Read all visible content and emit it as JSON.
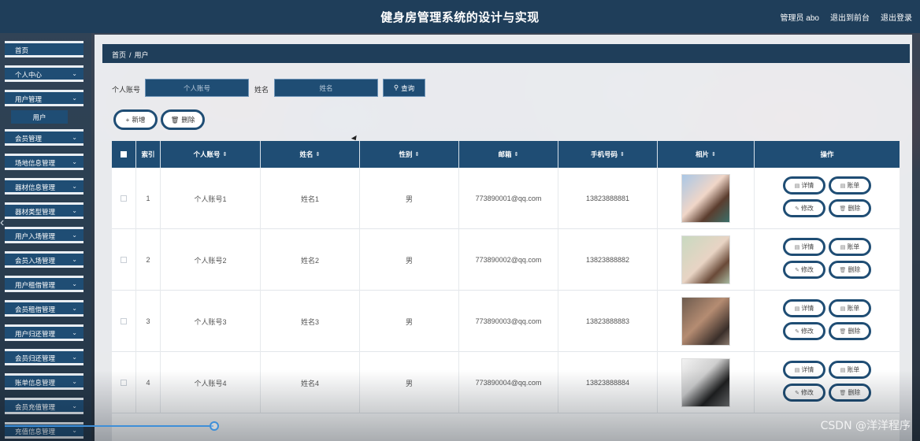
{
  "header": {
    "title": "健身房管理系统的设计与实现",
    "admin_label": "管理员 abo",
    "back_front": "退出到前台",
    "logout": "退出登录"
  },
  "sidebar": {
    "items": [
      {
        "label": "首页",
        "has_children": false
      },
      {
        "label": "个人中心",
        "has_children": true
      },
      {
        "label": "用户管理",
        "has_children": true,
        "expanded": true,
        "children": [
          {
            "label": "用户"
          }
        ]
      },
      {
        "label": "会员管理",
        "has_children": true
      },
      {
        "label": "场地信息管理",
        "has_children": true
      },
      {
        "label": "器材信息管理",
        "has_children": true
      },
      {
        "label": "器材类型管理",
        "has_children": true
      },
      {
        "label": "用户入场管理",
        "has_children": true
      },
      {
        "label": "会员入场管理",
        "has_children": true
      },
      {
        "label": "用户租借管理",
        "has_children": true
      },
      {
        "label": "会员租借管理",
        "has_children": true
      },
      {
        "label": "用户归还管理",
        "has_children": true
      },
      {
        "label": "会员归还管理",
        "has_children": true
      },
      {
        "label": "账单信息管理",
        "has_children": true
      },
      {
        "label": "会员充值管理",
        "has_children": true
      },
      {
        "label": "充值信息管理",
        "has_children": true
      }
    ]
  },
  "breadcrumb": {
    "home": "首页",
    "separator": "/",
    "current": "用户"
  },
  "search": {
    "account_label": "个人账号",
    "account_placeholder": "个人账号",
    "name_label": "姓名",
    "name_placeholder": "姓名",
    "query_button": "查询"
  },
  "actions": {
    "add": "新增",
    "delete": "删除"
  },
  "table": {
    "columns": [
      "索引",
      "个人账号",
      "姓名",
      "性别",
      "邮箱",
      "手机号码",
      "相片",
      "操作"
    ],
    "rows": [
      {
        "index": "1",
        "account": "个人账号1",
        "name": "姓名1",
        "gender": "男",
        "email": "773890001@qq.com",
        "phone": "13823888881"
      },
      {
        "index": "2",
        "account": "个人账号2",
        "name": "姓名2",
        "gender": "男",
        "email": "773890002@qq.com",
        "phone": "13823888882"
      },
      {
        "index": "3",
        "account": "个人账号3",
        "name": "姓名3",
        "gender": "男",
        "email": "773890003@qq.com",
        "phone": "13823888883"
      },
      {
        "index": "4",
        "account": "个人账号4",
        "name": "姓名4",
        "gender": "男",
        "email": "773890004@qq.com",
        "phone": "13823888884"
      }
    ],
    "row_actions": {
      "detail": "详情",
      "bill": "账单",
      "edit": "修改",
      "delete": "删除"
    }
  },
  "player": {
    "progress": 0.23
  },
  "watermark": "CSDN @洋洋程序",
  "colors": {
    "primary": "#1f4d74",
    "header": "#1f3e5a",
    "accent": "#3f8fd8"
  }
}
